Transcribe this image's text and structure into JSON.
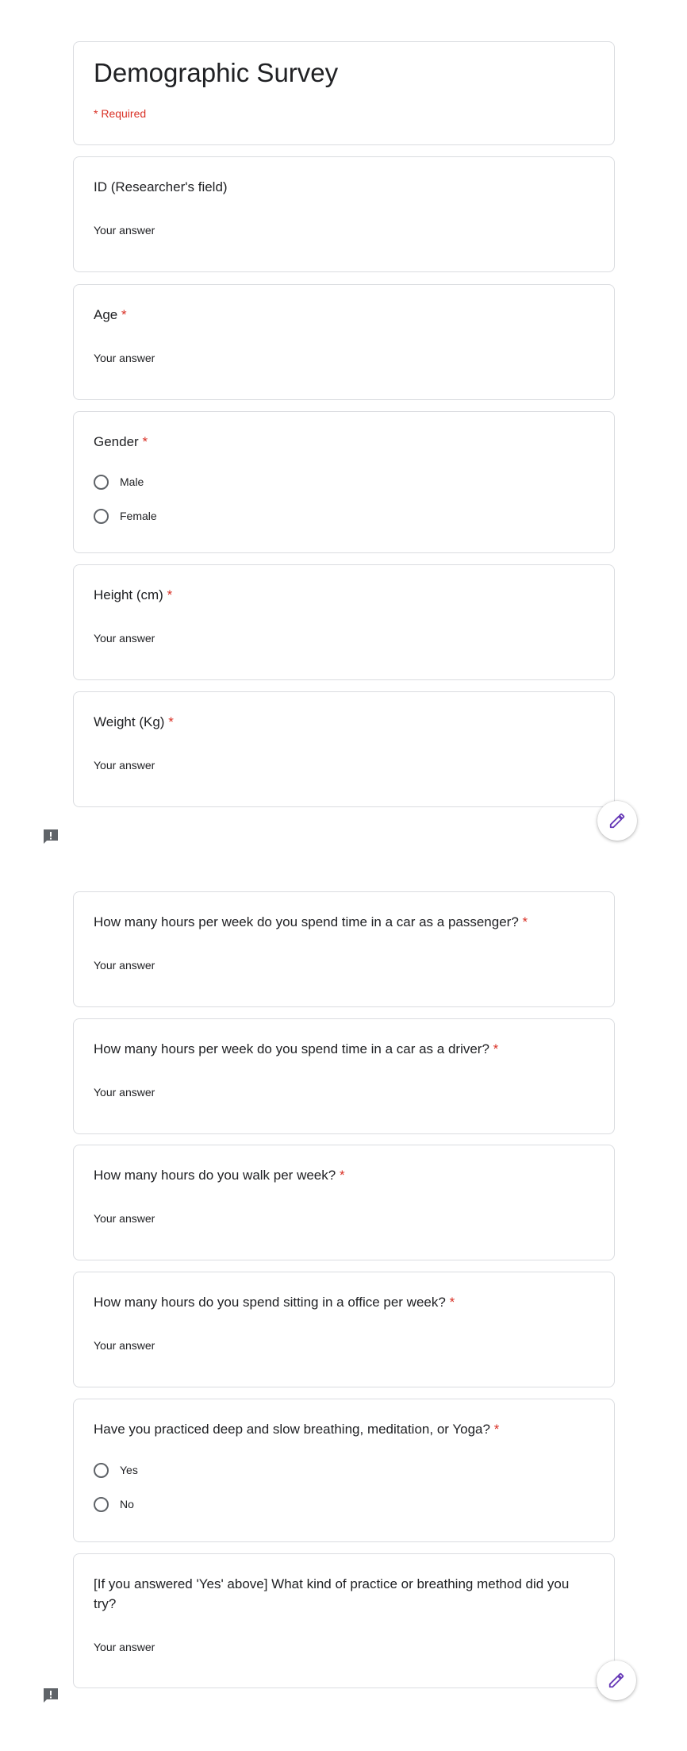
{
  "form": {
    "title": "Demographic Survey",
    "required_note": "* Required"
  },
  "questions": [
    {
      "title": "ID (Researcher's field)",
      "required": false,
      "placeholder": "Your answer"
    },
    {
      "title": "Age",
      "required": true,
      "placeholder": "Your answer"
    },
    {
      "title": "Gender",
      "required": true,
      "options": [
        "Male",
        "Female"
      ]
    },
    {
      "title": "Height (cm)",
      "required": true,
      "placeholder": "Your answer"
    },
    {
      "title": "Weight (Kg)",
      "required": true,
      "placeholder": "Your answer"
    },
    {
      "title": "How many hours per week do you spend time in a car as a passenger?",
      "required": true,
      "placeholder": "Your answer"
    },
    {
      "title": "How many hours per week do you spend time in a car as a driver?",
      "required": true,
      "placeholder": "Your answer"
    },
    {
      "title": "How many hours do you walk per week?",
      "required": true,
      "placeholder": "Your answer"
    },
    {
      "title": "How many hours do you spend sitting in a office per week?",
      "required": true,
      "placeholder": "Your answer"
    },
    {
      "title": "Have you practiced deep and slow breathing, meditation, or Yoga?",
      "required": true,
      "options": [
        "Yes",
        "No"
      ]
    },
    {
      "title": "[If you answered 'Yes' above] What kind of practice or breathing method did you try?",
      "required": false,
      "placeholder": "Your answer"
    }
  ],
  "required_marker": "*",
  "colors": {
    "accent": "#673ab7",
    "required": "#d93025",
    "border": "#dadce0"
  },
  "icons": {
    "edit": "pencil-icon",
    "feedback": "report-icon"
  }
}
